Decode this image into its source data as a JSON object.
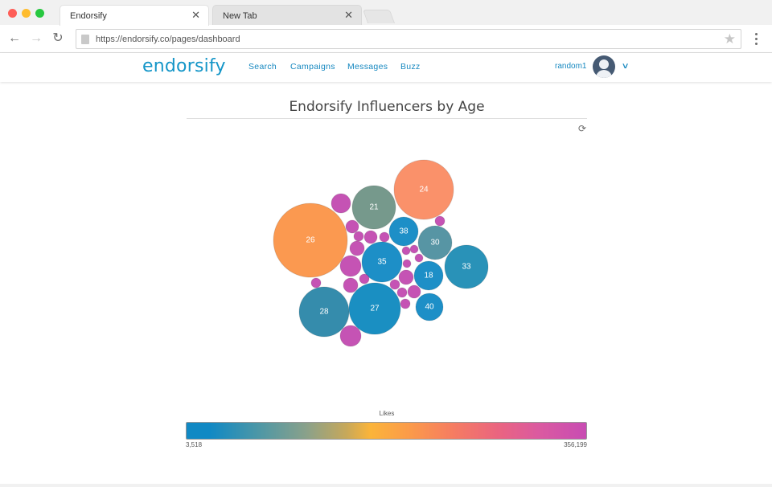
{
  "browser": {
    "active_tab_title": "Endorsify",
    "inactive_tab_title": "New Tab",
    "url": "https://endorsify.co/pages/dashboard"
  },
  "app": {
    "logo": "endorsify",
    "nav": [
      "Search",
      "Campaigns",
      "Messages",
      "Buzz"
    ],
    "username": "random1"
  },
  "chart_data": {
    "type": "bubble",
    "title": "Endorsify Influencers by Age",
    "legend_title": "Likes",
    "likes_min": "3,518",
    "likes_max": "356,199",
    "bubbles": [
      {
        "label": "26",
        "color": "#fb9447"
      },
      {
        "label": "24",
        "color": "#fa8b62"
      },
      {
        "label": "21",
        "color": "#6f9486"
      },
      {
        "label": "38",
        "color": "#1189c4"
      },
      {
        "label": "30",
        "color": "#4e8f9f"
      },
      {
        "label": "35",
        "color": "#1189c4"
      },
      {
        "label": "33",
        "color": "#1d8cb4"
      },
      {
        "label": "18",
        "color": "#1189c4"
      },
      {
        "label": "28",
        "color": "#2a86a8"
      },
      {
        "label": "27",
        "color": "#0e89bf"
      },
      {
        "label": "40",
        "color": "#1189c4"
      },
      {
        "label": "",
        "color": "#c24ab0"
      },
      {
        "label": "",
        "color": "#c24ab0"
      },
      {
        "label": "",
        "color": "#c24ab0"
      },
      {
        "label": "",
        "color": "#c24ab0"
      },
      {
        "label": "",
        "color": "#c24ab0"
      },
      {
        "label": "",
        "color": "#c24ab0"
      },
      {
        "label": "",
        "color": "#c24ab0"
      },
      {
        "label": "",
        "color": "#c24ab0"
      },
      {
        "label": "",
        "color": "#c24ab0"
      },
      {
        "label": "",
        "color": "#c24ab0"
      },
      {
        "label": "",
        "color": "#c24ab0"
      },
      {
        "label": "",
        "color": "#c24ab0"
      },
      {
        "label": "",
        "color": "#c24ab0"
      },
      {
        "label": "",
        "color": "#c24ab0"
      },
      {
        "label": "",
        "color": "#c24ab0"
      },
      {
        "label": "",
        "color": "#c24ab0"
      },
      {
        "label": "",
        "color": "#c24ab0"
      },
      {
        "label": "",
        "color": "#c24ab0"
      },
      {
        "label": "",
        "color": "#c24ab0"
      },
      {
        "label": "",
        "color": "#c24ab0"
      },
      {
        "label": "",
        "color": "#c24ab0"
      }
    ]
  }
}
